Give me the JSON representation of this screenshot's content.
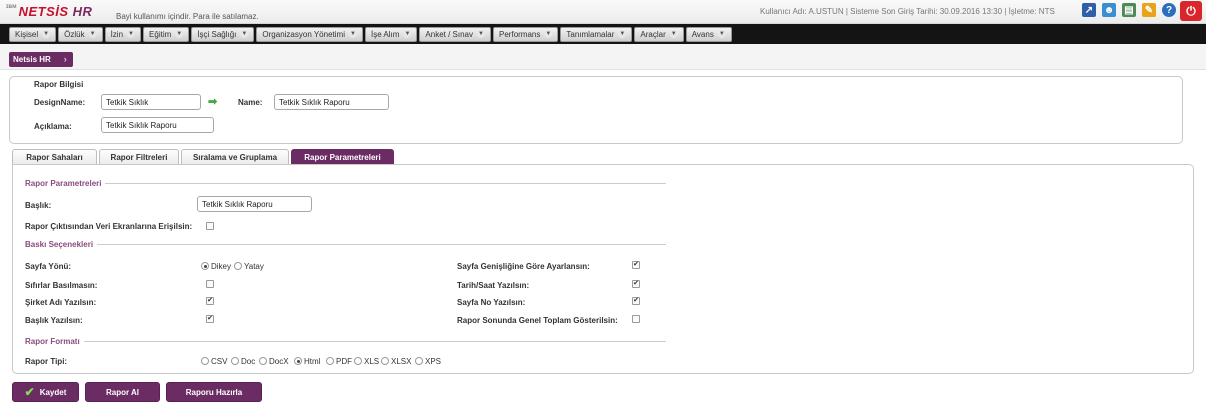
{
  "header": {
    "logo_small": "ɪʙᴍ",
    "logo_text": "NETSİS",
    "logo_hr": "HR",
    "marquee": "Bayi kullanımı içindir. Para ile satılamaz.",
    "user_info": "Kullanıcı Adı: A.USTUN | Sisteme Son Giriş Tarihi: 30.09.2016 13:30 | İşletme: NTS"
  },
  "menu": [
    "Kişisel",
    "Özlük",
    "İzin",
    "Eğitim",
    "İşçi Sağlığı",
    "Organizasyon Yönetimi",
    "İşe Alım",
    "Anket / Sınav",
    "Performans",
    "Tanımlamalar",
    "Araçlar",
    "Avans"
  ],
  "breadcrumb": {
    "label": "Netsis HR",
    "arrow": "›"
  },
  "rapor_bilgisi": {
    "title": "Rapor Bilgisi",
    "design_name_label": "DesignName:",
    "design_name_value": "Tetkik Sıklık",
    "name_label": "Name:",
    "name_value": "Tetkik Sıklık Raporu",
    "aciklama_label": "Açıklama:",
    "aciklama_value": "Tetkik Sıklık Raporu"
  },
  "tabs": [
    "Rapor Sahaları",
    "Rapor Filtreleri",
    "Sıralama ve Gruplama",
    "Rapor Parametreleri"
  ],
  "params": {
    "section_title": "Rapor Parametreleri",
    "baslik_label": "Başlık:",
    "baslik_value": "Tetkik Sıklık Raporu",
    "veri_label": "Rapor Çıktısından Veri Ekranlarına Erişilsin:",
    "veri_checked": false
  },
  "baski": {
    "section_title": "Baskı Seçenekleri",
    "sayfa_yonu_label": "Sayfa Yönü:",
    "dikey": "Dikey",
    "yatay": "Yatay",
    "sayfa_yonu_selected": "Dikey",
    "sifirlar_label": "Sıfırlar Basılmasın:",
    "sifirlar_checked": false,
    "sirket_label": "Şirket Adı Yazılsın:",
    "sirket_checked": true,
    "baslik_yaz_label": "Başlık Yazılsın:",
    "baslik_yaz_checked": true,
    "genislik_label": "Sayfa Genişliğine Göre Ayarlansın:",
    "genislik_checked": true,
    "tarih_label": "Tarih/Saat Yazılsın:",
    "tarih_checked": true,
    "sayfa_no_label": "Sayfa No Yazılsın:",
    "sayfa_no_checked": true,
    "toplam_label": "Rapor Sonunda Genel Toplam Gösterilsin:",
    "toplam_checked": false
  },
  "format": {
    "section_title": "Rapor Formatı",
    "tip_label": "Rapor Tipi:",
    "options": [
      "CSV",
      "Doc",
      "DocX",
      "Html",
      "PDF",
      "XLS",
      "XLSX",
      "XPS"
    ],
    "selected": "Html"
  },
  "buttons": {
    "kaydet": "Kaydet",
    "rapor_al": "Rapor Al",
    "raporu_hazirla": "Raporu Hazırla"
  },
  "colors": {
    "accent": "#6b2c63",
    "menubar": "#141414",
    "logo_red": "#c8102e",
    "power": "#d9262c"
  }
}
